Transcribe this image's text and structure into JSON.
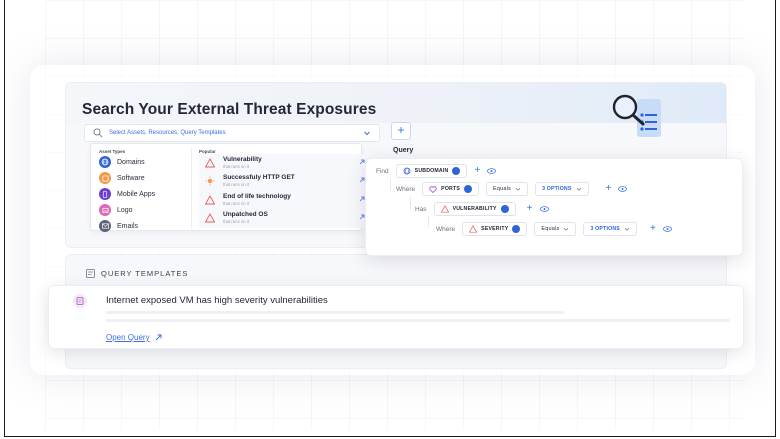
{
  "search": {
    "title": "Search Your External Threat Exposures",
    "placeholder": "Select Assets, Resources, Query Templates",
    "add_button": "+",
    "query_label": "Query"
  },
  "asset_types": {
    "heading": "Asset Types",
    "items": [
      {
        "label": "Domains",
        "color": "#2f63d8",
        "icon": "globe-icon"
      },
      {
        "label": "Software",
        "color": "#f2994a",
        "icon": "software-icon"
      },
      {
        "label": "Mobile Apps",
        "color": "#6b3fd6",
        "icon": "mobile-icon"
      },
      {
        "label": "Logo",
        "color": "#e066b8",
        "icon": "image-icon"
      },
      {
        "label": "Emails",
        "color": "#5c6475",
        "icon": "mail-icon"
      }
    ]
  },
  "popular": {
    "heading": "Popular",
    "items": [
      {
        "title": "Vulnerability",
        "sub": "that runs on it",
        "color": "#ea5b5b",
        "icon": "warning-icon"
      },
      {
        "title": "Successfuly HTTP GET",
        "sub": "that runs on it",
        "color": "#f2994a",
        "icon": "sun-icon"
      },
      {
        "title": "End of life technology",
        "sub": "that runs on it",
        "color": "#ea5b5b",
        "icon": "warning-icon"
      },
      {
        "title": "Unpatched OS",
        "sub": "that runs on it",
        "color": "#ea5b5b",
        "icon": "warning-icon"
      }
    ]
  },
  "query": {
    "find_label": "Find",
    "subdomain": "SUBDOMAIN",
    "where1_label": "Where",
    "ports": "PORTS",
    "equals1": "Equals",
    "options1": "3 OPTIONS",
    "has_label": "Has",
    "vulnerability": "VULNERABILITY",
    "where2_label": "Where",
    "severity": "SEVERITY",
    "equals2": "Equals",
    "options2": "3 OPTIONS"
  },
  "templates": {
    "heading": "QUERY TEMPLATES",
    "card_title": "Internet exposed VM has high severity vulnerabilities",
    "open_link": "Open Query"
  }
}
